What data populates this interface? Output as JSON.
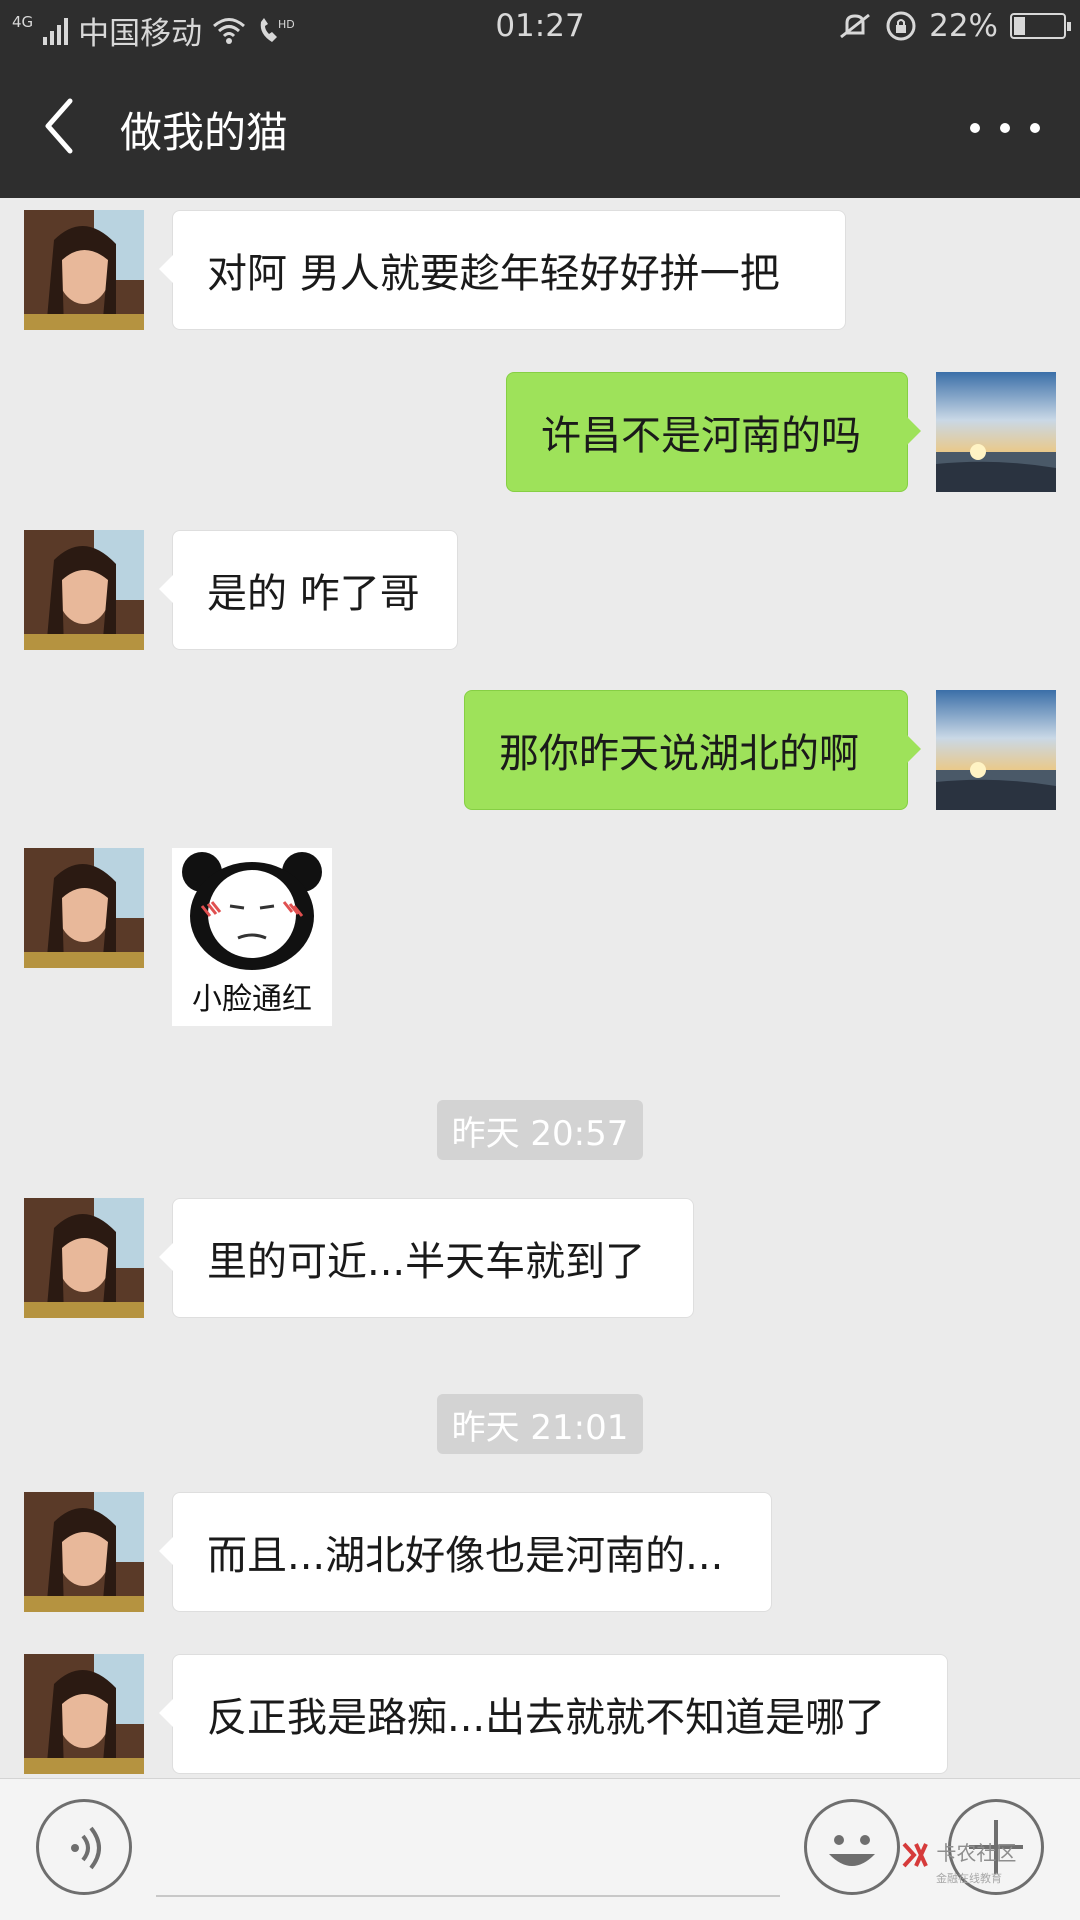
{
  "status_bar": {
    "network": "4G",
    "carrier": "中国移动",
    "time": "01:27",
    "battery": "22%",
    "battery_level": 0.22
  },
  "header": {
    "title": "做我的猫",
    "back_icon": "chevron-left-icon",
    "more_icon": "more-dots-icon"
  },
  "messages": [
    {
      "side": "in",
      "text": "对阿  男人就要趁年轻好好拼一把"
    },
    {
      "side": "out",
      "text": "许昌不是河南的吗"
    },
    {
      "side": "in",
      "text": "是的 咋了哥"
    },
    {
      "side": "out",
      "text": "那你昨天说湖北的啊"
    },
    {
      "side": "in",
      "type": "sticker",
      "caption": "小脸通红"
    },
    {
      "type": "time",
      "text": "昨天 20:57"
    },
    {
      "side": "in",
      "text": "里的可近...半天车就到了"
    },
    {
      "type": "time",
      "text": "昨天 21:01"
    },
    {
      "side": "in",
      "text": "而且...湖北好像也是河南的..."
    },
    {
      "side": "in",
      "text": "反正我是路痴...出去就就不知道是哪了"
    }
  ],
  "input_bar": {
    "voice_icon": "voice-icon",
    "emoji_icon": "emoji-icon",
    "plus_icon": "plus-icon",
    "watermark": "卡农社区",
    "watermark_sub": "金融在线教育"
  },
  "colors": {
    "header_bg": "#2e2e2e",
    "chat_bg": "#ebebeb",
    "bubble_out": "#9ee25a",
    "bubble_in": "#ffffff"
  }
}
